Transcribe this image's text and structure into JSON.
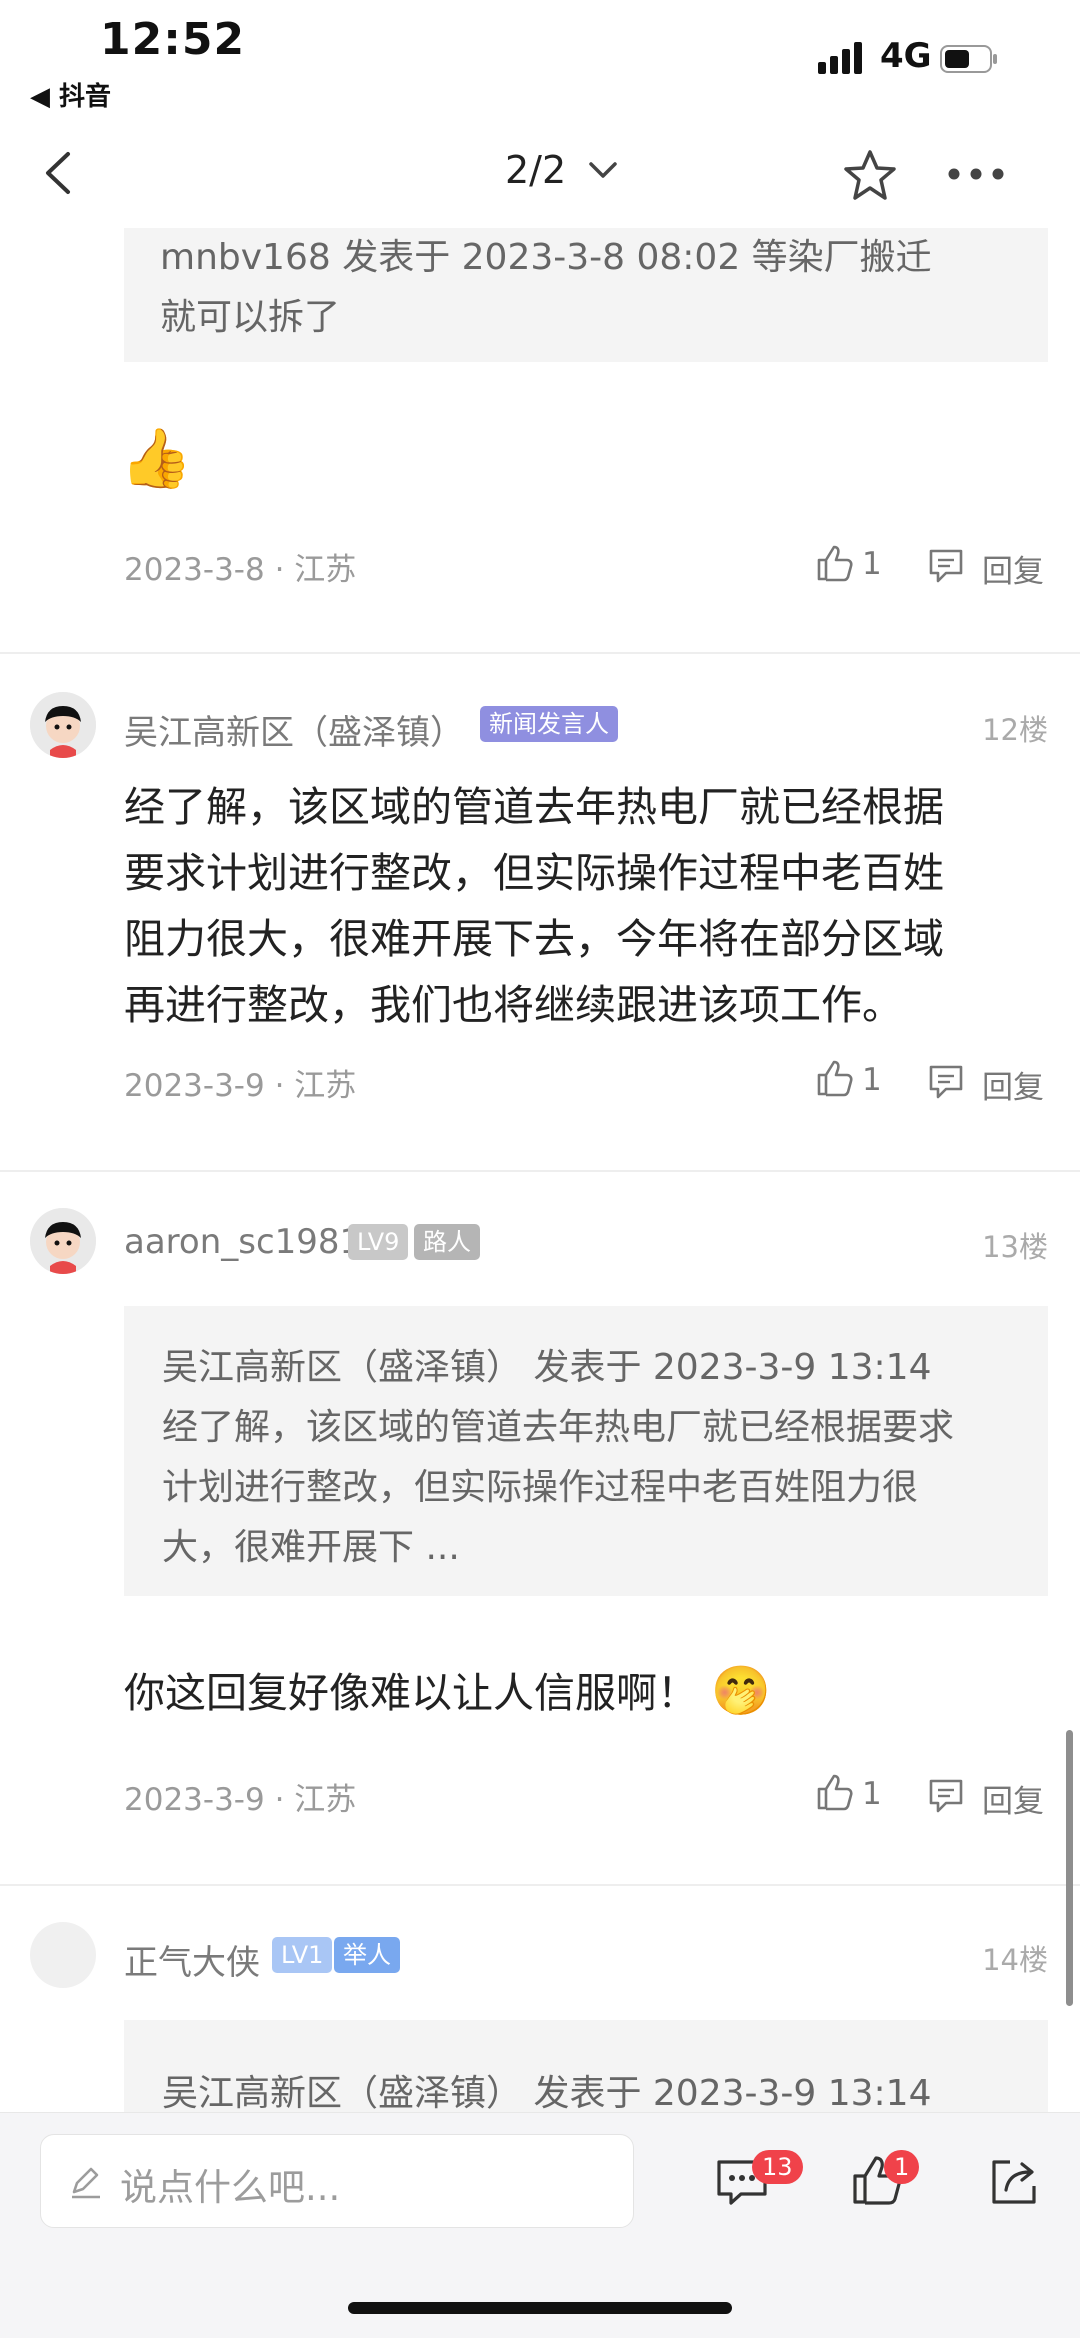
{
  "status_bar": {
    "time": "12:52",
    "back_app": "◀ 抖音",
    "network": "4G"
  },
  "nav": {
    "page_indicator": "2/2"
  },
  "post_top": {
    "quote": "mnbv168 发表于 2023-3-8 08:02 等染厂搬迁就可以拆了",
    "quote_line1": "mnbv168 发表于 2023-3-8 08:02 等染厂搬迁",
    "quote_line2": "就可以拆了",
    "emoji": "👍",
    "meta": "2023-3-8 · 江苏",
    "likes": "1",
    "reply": "回复"
  },
  "posts": [
    {
      "username": "吴江高新区（盛泽镇）",
      "badge": "新闻发言人",
      "floor": "12楼",
      "lines": [
        "经了解，该区域的管道去年热电厂就已经根据",
        "要求计划进行整改，但实际操作过程中老百姓",
        "阻力很大，很难开展下去，今年将在部分区域",
        "再进行整改，我们也将继续跟进该项工作。"
      ],
      "meta": "2023-3-9 · 江苏",
      "likes": "1",
      "reply": "回复"
    },
    {
      "username": "aaron_sc1981",
      "level": "LV9",
      "badge": "路人",
      "floor": "13楼",
      "quote_lines": [
        "吴江高新区（盛泽镇） 发表于 2023-3-9 13:14",
        "经了解，该区域的管道去年热电厂就已经根据要求",
        "计划进行整改，但实际操作过程中老百姓阻力很",
        "大，很难开展下 ..."
      ],
      "text": "你这回复好像难以让人信服啊！",
      "emoji": "🤭",
      "meta": "2023-3-9 · 江苏",
      "likes": "1",
      "reply": "回复"
    },
    {
      "username": "正气大侠",
      "level": "LV1",
      "badge": "举人",
      "floor": "14楼",
      "quote_first_line": "吴江高新区（盛泽镇） 发表于 2023-3-9 13:14"
    }
  ],
  "bottom_bar": {
    "placeholder": "说点什么吧...",
    "comment_count": "13",
    "like_count": "1"
  },
  "colors": {
    "badge_spokesperson": "#8f8fe0",
    "badge_level_gray": "#c8c8c8",
    "badge_role_gray": "#b5b5b5",
    "badge_level_blue": "#a9c6f5",
    "badge_role_blue": "#79a8ef",
    "count_badge": "#f0424a"
  }
}
